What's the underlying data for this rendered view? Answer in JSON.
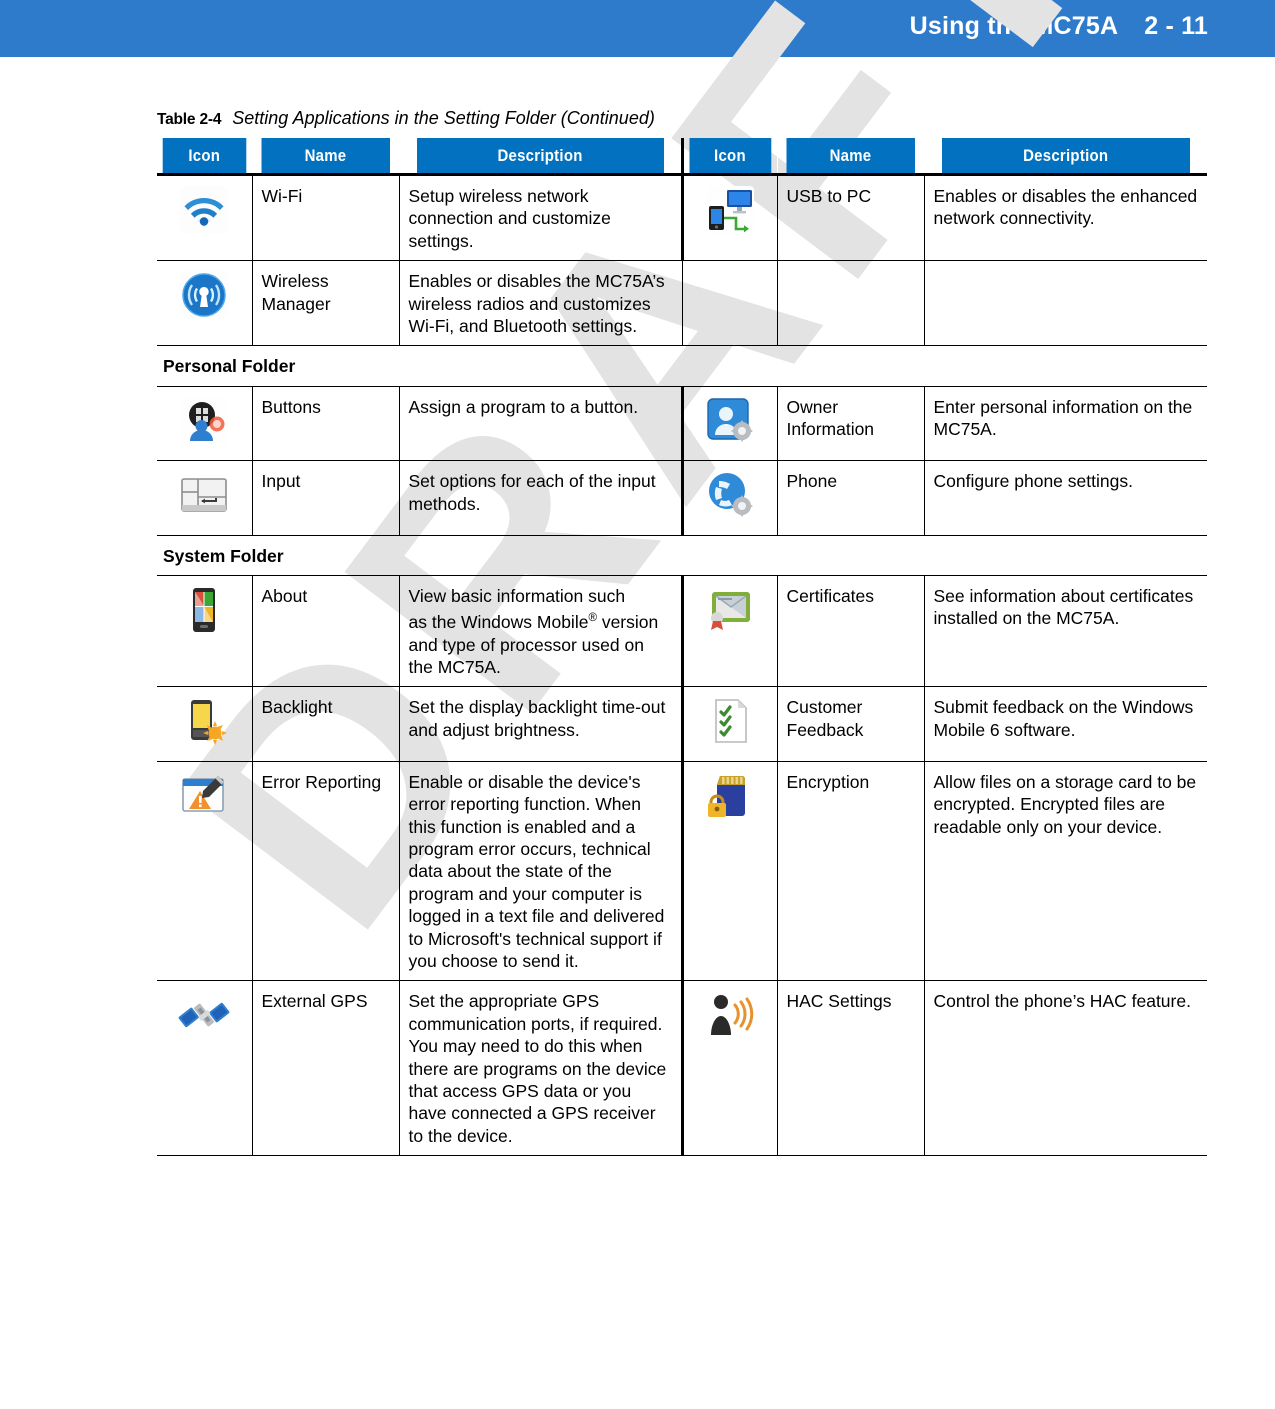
{
  "header": {
    "title": "Using the MC75A",
    "page_number": "2 - 11",
    "background_color": "#2E7BCC"
  },
  "watermark": {
    "text": "DRAFT",
    "color": "#e3e3e3"
  },
  "table": {
    "caption_number": "Table 2-4",
    "caption_title": "Setting Applications in the Setting Folder (Continued)",
    "header_color": "#0272C0",
    "columns": [
      "Icon",
      "Name",
      "Description",
      "Icon",
      "Name",
      "Description"
    ],
    "rows": [
      {
        "left": {
          "icon": "wifi-icon",
          "name": "Wi-Fi",
          "description": "Setup wireless network connection and customize settings."
        },
        "right": {
          "icon": "usb-to-pc-icon",
          "name": "USB to PC",
          "description": "Enables or disables the enhanced network connectivity."
        }
      },
      {
        "left": {
          "icon": "wireless-manager-icon",
          "name": "Wireless Manager",
          "description": "Enables or disables the MC75A’s wireless radios and customizes Wi-Fi, and Bluetooth settings."
        },
        "right": {
          "icon": "",
          "name": "",
          "description": ""
        }
      }
    ],
    "personal_folder_label": "Personal Folder",
    "personal_rows": [
      {
        "left": {
          "icon": "buttons-icon",
          "name": "Buttons",
          "description": "Assign a program to a button."
        },
        "right": {
          "icon": "owner-information-icon",
          "name": "Owner Information",
          "description": "Enter personal information on the MC75A."
        }
      },
      {
        "left": {
          "icon": "input-icon",
          "name": "Input",
          "description": "Set options for each of the input methods."
        },
        "right": {
          "icon": "phone-icon",
          "name": "Phone",
          "description": "Configure phone settings."
        }
      }
    ],
    "system_folder_label": "System Folder",
    "system_rows": [
      {
        "left": {
          "icon": "about-icon",
          "name": "About",
          "description_part1": "View basic information such",
          "description_part2": "as the Windows Mobile",
          "description_sup": "®",
          "description_part3": "version and type of processor used on the MC75A."
        },
        "right": {
          "icon": "certificates-icon",
          "name": "Certificates",
          "description": "See information about certificates installed on the MC75A."
        }
      },
      {
        "left": {
          "icon": "backlight-icon",
          "name": "Backlight",
          "description": "Set the display backlight time-out and adjust brightness."
        },
        "right": {
          "icon": "customer-feedback-icon",
          "name": "Customer Feedback",
          "description": "Submit feedback on the Windows Mobile 6 software."
        }
      },
      {
        "left": {
          "icon": "error-reporting-icon",
          "name": "Error Reporting",
          "description": "Enable or disable the device's error reporting function. When this function is enabled and a program error occurs, technical data about the state of the program and your computer is logged in a text file and delivered to Microsoft's technical support if you choose to send it."
        },
        "right": {
          "icon": "encryption-icon",
          "name": "Encryption",
          "description": "Allow files on a storage card to be encrypted. Encrypted files are readable only on your device."
        }
      },
      {
        "left": {
          "icon": "external-gps-icon",
          "name": "External GPS",
          "description": "Set the appropriate GPS communication ports, if required. You may need to do this when there are programs on the device that access GPS data or you have connected a GPS receiver to the device."
        },
        "right": {
          "icon": "hac-settings-icon",
          "name": "HAC Settings",
          "description": "Control the phone’s HAC feature."
        }
      }
    ]
  }
}
